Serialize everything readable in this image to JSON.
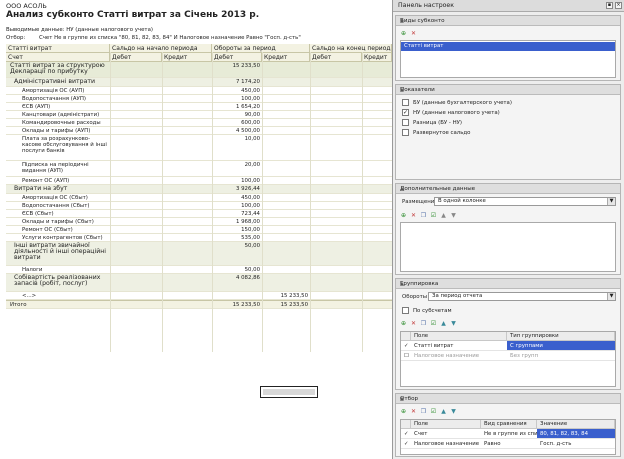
{
  "report": {
    "org": "ООО АСОЛЬ",
    "title": "Анализ субконто Статті витрат за Січень 2013 р.",
    "line1": "Выводимые данные:  НУ (данные налогового учета)",
    "line2_label": "Отбор:",
    "line2_value": "Счет Не в группе из списка \"80, 81, 82, 83, 84\" И Налоговое назначение Равно \"Госп. д-сть\"",
    "headers": {
      "col1": "Статті витрат",
      "col1b": "Счет",
      "start": "Сальдо на начало периода",
      "turnover": "Обороты за период",
      "end": "Сальдо на конец периода",
      "debit": "Дебет",
      "credit": "Кредит"
    },
    "rows": [
      {
        "lvl": 0,
        "name": "Статті витрат за структурою Декларації по прибутку",
        "d": "15 233,50",
        "c": "",
        "h": 16,
        "pm": ""
      },
      {
        "lvl": 1,
        "name": "Адміністративні витрати",
        "d": "7 174,20",
        "c": "",
        "h": 9,
        "pm": "-"
      },
      {
        "lvl": 2,
        "name": "Амортизація ОС (АУП)",
        "d": "450,00",
        "c": "",
        "h": 8,
        "pm": "+"
      },
      {
        "lvl": 2,
        "name": "Водопостачання (АУП)",
        "d": "100,00",
        "c": "",
        "h": 8,
        "pm": "+"
      },
      {
        "lvl": 2,
        "name": "ЄСВ (АУП)",
        "d": "1 654,20",
        "c": "",
        "h": 8,
        "pm": "+"
      },
      {
        "lvl": 2,
        "name": "Канцтовари (адміністрати)",
        "d": "90,00",
        "c": "",
        "h": 8,
        "pm": "+"
      },
      {
        "lvl": 2,
        "name": "Командировочные расходы (АУП)",
        "d": "600,00",
        "c": "",
        "h": 8,
        "pm": "+"
      },
      {
        "lvl": 2,
        "name": "Оклады и тарифы (АУП)",
        "d": "4 500,00",
        "c": "",
        "h": 8,
        "pm": "+"
      },
      {
        "lvl": 2,
        "name": "Плата за розрахунково-касове обслуговування й інші послуги банків",
        "d": "10,00",
        "c": "",
        "h": 26,
        "pm": "+"
      },
      {
        "lvl": 2,
        "name": "Підписка на періодичні видання (АУП)",
        "d": "20,00",
        "c": "",
        "h": 16,
        "pm": "+"
      },
      {
        "lvl": 2,
        "name": "Ремонт ОС (АУП)",
        "d": "100,00",
        "c": "",
        "h": 8,
        "pm": "+"
      },
      {
        "lvl": 1,
        "name": "Витрати на збут",
        "d": "3 926,44",
        "c": "",
        "h": 9,
        "pm": "-"
      },
      {
        "lvl": 2,
        "name": "Амортизація ОС (Сбыт)",
        "d": "450,00",
        "c": "",
        "h": 8,
        "pm": "+"
      },
      {
        "lvl": 2,
        "name": "Водопостачання (Сбыт)",
        "d": "100,00",
        "c": "",
        "h": 8,
        "pm": "+"
      },
      {
        "lvl": 2,
        "name": "ЄСВ (Сбыт)",
        "d": "723,44",
        "c": "",
        "h": 8,
        "pm": "+"
      },
      {
        "lvl": 2,
        "name": "Оклады и тарифы (Сбыт)",
        "d": "1 968,00",
        "c": "",
        "h": 8,
        "pm": "+"
      },
      {
        "lvl": 2,
        "name": "Ремонт ОС (Сбыт)",
        "d": "150,00",
        "c": "",
        "h": 8,
        "pm": "+"
      },
      {
        "lvl": 2,
        "name": "Услуги контрагентов (Сбыт)",
        "d": "535,00",
        "c": "",
        "h": 8,
        "pm": "+"
      },
      {
        "lvl": 1,
        "name": "Інші витрати звичайної діяльності й інші операційні витрати",
        "d": "50,00",
        "c": "",
        "h": 24,
        "pm": "-"
      },
      {
        "lvl": 2,
        "name": "Налоги",
        "d": "50,00",
        "c": "",
        "h": 8,
        "pm": "+"
      },
      {
        "lvl": 1,
        "name": "Собівартість реалізованих запасів (робіт, послуг)",
        "d": "4 082,86",
        "c": "",
        "h": 18,
        "pm": "+"
      },
      {
        "lvl": 2,
        "name": "<...>",
        "d": "",
        "c": "15 233,50",
        "h": 8,
        "pm": ""
      }
    ],
    "total": {
      "name": "Итого",
      "d": "15 233,50",
      "c": "15 233,50"
    }
  },
  "panel": {
    "title": "Панель настроек",
    "sec_subconto": {
      "title": "Виды субконто",
      "item": "Статті витрат"
    },
    "sec_indicators": {
      "title": "Показатели",
      "items": [
        {
          "label": "БУ (данные бухгалтерского учета)",
          "checked": false
        },
        {
          "label": "НУ (данные налогового учета)",
          "checked": true
        },
        {
          "label": "Разница (БУ - НУ)",
          "checked": false
        },
        {
          "label": "Развернутое сальдо",
          "checked": false
        }
      ]
    },
    "sec_extra": {
      "title": "Дополнительные данные",
      "place_label": "Размещение:",
      "place_value": "В одной колонке"
    },
    "sec_group": {
      "title": "Группировка",
      "turn_label": "Обороты",
      "turn_value": "За период отчета",
      "by_subaccounts": "По субсчетам",
      "col_field": "Поле",
      "col_type": "Тип группировки",
      "rows": [
        {
          "field": "Статті витрат",
          "type": "С группами",
          "checked": true,
          "gray": false
        },
        {
          "field": "Налоговое назначение",
          "type": "Без групп",
          "checked": false,
          "gray": true
        }
      ]
    },
    "sec_filter": {
      "title": "Отбор",
      "col_field": "Поле",
      "col_cmp": "Вид сравнения",
      "col_val": "Значение",
      "rows": [
        {
          "field": "Счет",
          "cmp": "Не в группе из списк...",
          "val": "80, 81, 82, 83, 84",
          "checked": true
        },
        {
          "field": "Налоговое назначение",
          "cmp": "Равно",
          "val": "Госп. д-сть",
          "checked": true
        }
      ]
    }
  }
}
